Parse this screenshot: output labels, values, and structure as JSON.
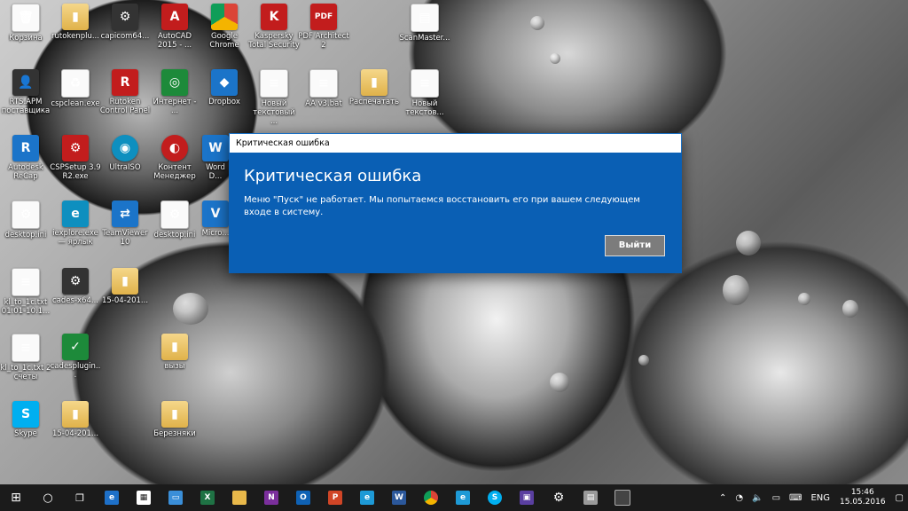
{
  "desktop_icons": [
    {
      "label": "Корзина",
      "icon": "recycle-bin-icon"
    },
    {
      "label": "rutokenplu...",
      "icon": "folder-icon"
    },
    {
      "label": "capicom64...",
      "icon": "installer-icon"
    },
    {
      "label": "AutoCAD 2015 - ...",
      "icon": "autocad-icon"
    },
    {
      "label": "Google Chrome",
      "icon": "chrome-icon"
    },
    {
      "label": "Kaspersky Total Security",
      "icon": "kaspersky-icon"
    },
    {
      "label": "PDF Architect 2",
      "icon": "pdf-icon"
    },
    {
      "label": "ScanMaster...",
      "icon": "file-icon"
    },
    {
      "label": "RTS.APM поставщика",
      "icon": "user-icon"
    },
    {
      "label": "cspclean.exe",
      "icon": "recycle-icon"
    },
    {
      "label": "Rutoken Control Panel",
      "icon": "rutoken-icon"
    },
    {
      "label": "Интернет - ...",
      "icon": "internet-icon"
    },
    {
      "label": "Dropbox",
      "icon": "dropbox-icon"
    },
    {
      "label": "Новый текстовый ...",
      "icon": "text-file-icon"
    },
    {
      "label": "АА v3.bat",
      "icon": "bat-file-icon"
    },
    {
      "label": "Распечатать",
      "icon": "folder-icon"
    },
    {
      "label": "Новый текстов...",
      "icon": "text-file-icon"
    },
    {
      "label": "Autodesk ReCap",
      "icon": "recap-icon"
    },
    {
      "label": "CSPSetup 3.9 R2.exe",
      "icon": "setup-icon"
    },
    {
      "label": "UltraISO",
      "icon": "ultraiso-icon"
    },
    {
      "label": "Контент Менеджер",
      "icon": "content-manager-icon"
    },
    {
      "label": "Word D...",
      "icon": "word-icon"
    },
    {
      "label": "desktop.ini",
      "icon": "ini-file-icon"
    },
    {
      "label": "iexplore.exe — ярлык",
      "icon": "ie-icon"
    },
    {
      "label": "TeamViewer 10",
      "icon": "teamviewer-icon"
    },
    {
      "label": "desktop.ini",
      "icon": "ini-file-icon"
    },
    {
      "label": "Micro...",
      "icon": "visio-icon"
    },
    {
      "label": "kl_to_1c.txt 01.01-10.1...",
      "icon": "text-file-icon"
    },
    {
      "label": "cades-x64...",
      "icon": "installer-icon"
    },
    {
      "label": "15-04-201...",
      "icon": "folder-icon"
    },
    {
      "label": "kl_to_1c.txt 2 счеты",
      "icon": "text-file-icon"
    },
    {
      "label": "cadesplugin...",
      "icon": "certificate-icon"
    },
    {
      "label": "вызы",
      "icon": "folder-icon"
    },
    {
      "label": "Skype",
      "icon": "skype-icon"
    },
    {
      "label": "15-04-201...",
      "icon": "folder-icon"
    },
    {
      "label": "Березняки",
      "icon": "folder-icon"
    }
  ],
  "dialog": {
    "window_title": "Критическая ошибка",
    "heading": "Критическая ошибка",
    "message": "Меню \"Пуск\" не работает. Мы попытаемся восстановить его при вашем следующем входе в систему.",
    "exit_button": "Выйти"
  },
  "taskbar": {
    "apps": [
      "start",
      "search",
      "task-view",
      "edge",
      "store",
      "remote-desktop",
      "excel",
      "file-explorer",
      "onenote",
      "outlook",
      "powerpoint",
      "internet-explorer",
      "word",
      "chrome",
      "edge",
      "skype",
      "save",
      "settings",
      "scanner",
      "window"
    ],
    "language": "ENG",
    "time": "15:46",
    "date": "15.05.2016"
  },
  "colors": {
    "dialog_blue": "#0a5fb4",
    "taskbar": "#1b1b1b",
    "button_gray": "#7c7c7c"
  }
}
